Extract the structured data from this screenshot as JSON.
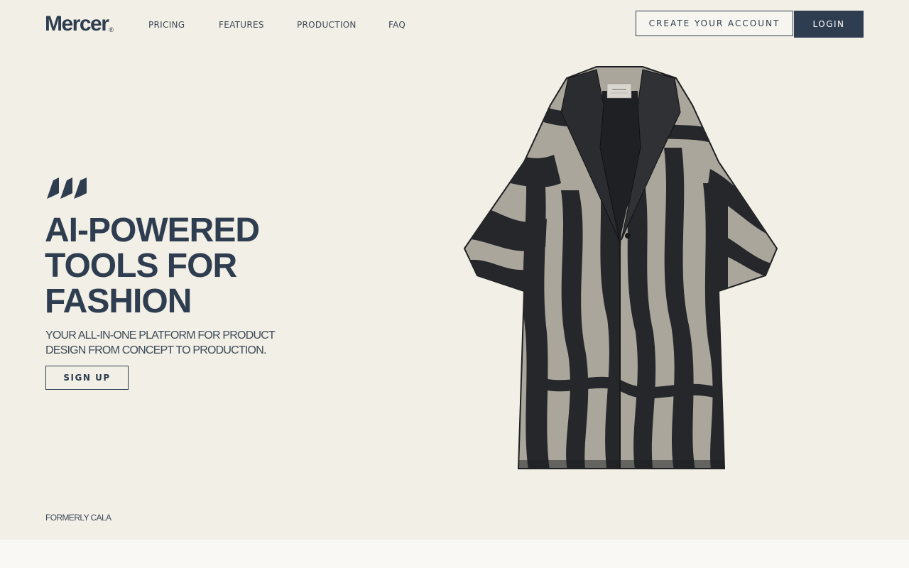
{
  "header": {
    "logo": "Mercer",
    "logo_mark": "®",
    "nav": [
      "PRICING",
      "FEATURES",
      "PRODUCTION",
      "FAQ"
    ],
    "create_account_label": "CREATE YOUR ACCOUNT",
    "login_label": "LOGIN"
  },
  "hero": {
    "title_lines": [
      "AI-POWERED",
      "TOOLS FOR",
      "FASHION"
    ],
    "subtitle_lines": [
      "YOUR ALL-IN-ONE PLATFORM FOR PRODUCT",
      "DESIGN FROM CONCEPT TO PRODUCTION."
    ],
    "signup_label": "SIGN UP",
    "brand_mark_icon": "triple-slash-logo-icon",
    "product_image": "zebra-print-oversized-shirt-jacket"
  },
  "footer": {
    "formerly": "FORMERLY CALA"
  },
  "colors": {
    "background": "#f2efe6",
    "primary": "#2e3d4f",
    "footer_band": "#f9f8f4"
  }
}
